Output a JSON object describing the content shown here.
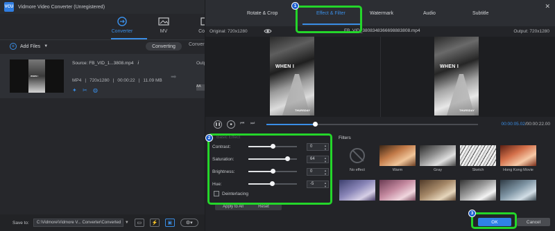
{
  "app": {
    "title": "Vidmore Video Converter (Unregistered)",
    "logo_text": "VCU"
  },
  "nav": [
    {
      "label": "Converter",
      "icon": "converter-icon",
      "active": true
    },
    {
      "label": "MV",
      "icon": "mv-icon",
      "active": false
    },
    {
      "label": "Collag",
      "icon": "collage-icon",
      "active": false
    }
  ],
  "toolbar": {
    "add_files": "Add Files",
    "converting": "Converting",
    "converted": "Conver"
  },
  "file": {
    "source": "Source: FB_VID_1...3808.mp4",
    "format": "MP4",
    "resolution": "720x1280",
    "duration": "00:00:22",
    "size": "11.09 MB",
    "output_label": "Outp",
    "output_box": "AA"
  },
  "bottom": {
    "save_to": "Save to:",
    "path": "C:\\Vidmore\\Vidmore V... Converter\\Converted"
  },
  "dialog": {
    "tabs": [
      "Rotate & Crop",
      "Effect & Filter",
      "Watermark",
      "Audio",
      "Subtitle"
    ],
    "active_tab": "Effect & Filter",
    "original_label": "Original: 720x1280",
    "file_title": "FB_VID_3808348366698883808.mp4",
    "output_label": "Output: 720x1280",
    "preview_text": "WHEN I",
    "preview_subtext": "THURSDAY",
    "time_current": "00:00:05.02",
    "time_total": "/00:00:22.00",
    "progress": 0.23
  },
  "basic_effect": {
    "title": "Basic Effect",
    "sliders": [
      {
        "label": "Contrast:",
        "value": "0",
        "fill": 0.5
      },
      {
        "label": "Saturation:",
        "value": "64",
        "fill": 0.8
      },
      {
        "label": "Brightness:",
        "value": "0",
        "fill": 0.5
      },
      {
        "label": "Hue:",
        "value": "-5",
        "fill": 0.48
      }
    ],
    "deinterlacing": "Deinterlacing",
    "apply_all": "Apply to All",
    "reset": "Reset"
  },
  "filters": {
    "label": "Filters",
    "items": [
      {
        "name": "No effect"
      },
      {
        "name": "Warm"
      },
      {
        "name": "Gray"
      },
      {
        "name": "Sketch"
      },
      {
        "name": "Hong Kong Movie"
      }
    ]
  },
  "buttons": {
    "ok": "OK",
    "cancel": "Cancel"
  },
  "annotations": [
    "1",
    "2",
    "3"
  ],
  "colors": {
    "accent": "#3a8ee6",
    "annotation": "#24d62a",
    "marker": "#1e5fd0"
  }
}
